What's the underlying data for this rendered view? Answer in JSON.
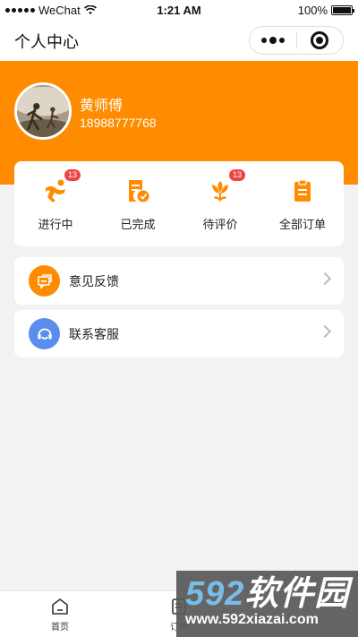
{
  "status_bar": {
    "carrier": "WeChat",
    "time": "1:21 AM",
    "battery": "100%"
  },
  "navbar": {
    "title": "个人中心"
  },
  "profile": {
    "name": "黄师傅",
    "phone": "18988777768"
  },
  "orders": {
    "items": [
      {
        "label": "进行中",
        "badge": "13",
        "icon": "runner-icon"
      },
      {
        "label": "已完成",
        "badge": "",
        "icon": "completed-doc-icon"
      },
      {
        "label": "待评价",
        "badge": "13",
        "icon": "flower-icon"
      },
      {
        "label": "全部订单",
        "badge": "",
        "icon": "clipboard-icon"
      }
    ]
  },
  "menu": {
    "feedback": {
      "label": "意见反馈",
      "icon": "chat-icon",
      "color": "#ff8c00"
    },
    "service": {
      "label": "联系客服",
      "icon": "headset-icon",
      "color": "#5b8def"
    }
  },
  "tabbar": {
    "tabs": [
      {
        "label": "首页",
        "icon": "home-icon"
      },
      {
        "label": "订单",
        "icon": "orders-icon"
      }
    ]
  },
  "watermark": {
    "brand": "592软件园",
    "url": "www.592xiazai.com"
  },
  "colors": {
    "accent": "#ff8c00",
    "badge": "#ef4444"
  }
}
